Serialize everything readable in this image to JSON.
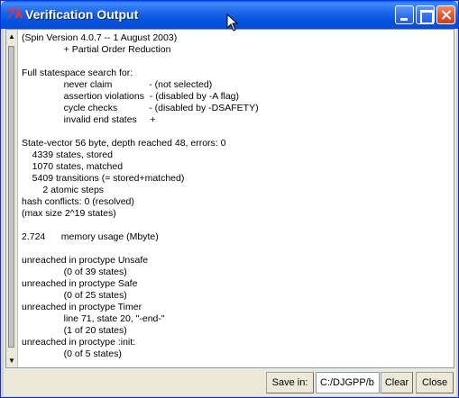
{
  "window": {
    "title": "Verification Output",
    "app_icon": "7k"
  },
  "output": {
    "text": "(Spin Version 4.0.7 -- 1 August 2003)\n                + Partial Order Reduction\n\nFull statespace search for:\n                never claim              - (not selected)\n                assertion violations  - (disabled by -A flag)\n                cycle checks            - (disabled by -DSAFETY)\n                invalid end states     +\n\nState-vector 56 byte, depth reached 48, errors: 0\n    4339 states, stored\n    1070 states, matched\n    5409 transitions (= stored+matched)\n        2 atomic steps\nhash conflicts: 0 (resolved)\n(max size 2^19 states)\n\n2.724      memory usage (Mbyte)\n\nunreached in proctype Unsafe\n                (0 of 39 states)\nunreached in proctype Safe\n                (0 of 25 states)\nunreached in proctype Timer\n                line 71, state 20, \"-end-\"\n                (1 of 20 states)\nunreached in proctype :init:\n                (0 of 5 states)"
  },
  "scrollbar": {
    "up_glyph": "▲",
    "down_glyph": "▼"
  },
  "toolbar": {
    "save_in_label": "Save in:",
    "path_value": "C:/DJGPP/b",
    "clear_label": "Clear",
    "close_label": "Close"
  }
}
